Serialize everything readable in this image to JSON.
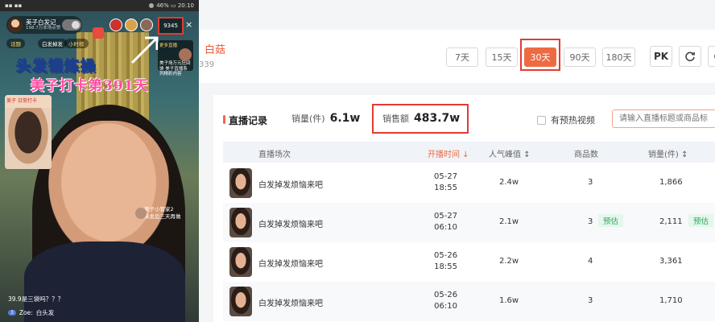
{
  "phone": {
    "status_left": "▪▪ ▪▪",
    "status_right": "46% ▭ 20:10",
    "host_name": "美子白发记",
    "host_likes": "198.7万本场点赞",
    "viewer_count": "9345",
    "close": "×",
    "tags": [
      "话题",
      "白发掉发",
      "小时榜"
    ],
    "more_live_title": "更多直播",
    "more_live_sub": "美子场万元狂回馈 美子直播系列精彩内容",
    "title_line1": "头发锻炼操",
    "title_line2": "美子打卡第391天",
    "product_banner": "美子 日常打卡",
    "assistant_name": "美子小管家2",
    "assistant_msg": "染发后三天再做",
    "comment1": "39.9是三袋吗？？？",
    "comment2_level": "3",
    "comment2_user": "Zoe:",
    "comment2_text": "白头发"
  },
  "header": {
    "brand": "白菇",
    "brand_sub": "339",
    "ranges": [
      "7天",
      "15天",
      "30天",
      "90天",
      "180天"
    ],
    "active_range": "30天",
    "pk_label": "PK"
  },
  "section": {
    "title": "直播记录",
    "sales_qty_label": "销量(件)",
    "sales_qty_value": "6.1w",
    "sales_amount_label": "销售额",
    "sales_amount_value": "483.7w",
    "preheat_label": "有预热视频",
    "search_placeholder": "请输入直播标题或商品标"
  },
  "table": {
    "headers": {
      "session": "直播场次",
      "start_time": "开播时间 ↓",
      "peak": "人气峰值 ↕",
      "goods": "商品数",
      "sales": "销量(件) ↕"
    },
    "estimate_label": "预估",
    "rows": [
      {
        "name": "白发掉发烦恼来吧",
        "date": "05-27",
        "time": "18:55",
        "peak": "2.4w",
        "goods": "3",
        "sales": "1,866",
        "estimated": false
      },
      {
        "name": "白发掉发烦恼来吧",
        "date": "05-27",
        "time": "06:10",
        "peak": "2.1w",
        "goods": "3",
        "sales": "2,111",
        "estimated": true
      },
      {
        "name": "白发掉发烦恼来吧",
        "date": "05-26",
        "time": "18:55",
        "peak": "2.2w",
        "goods": "4",
        "sales": "3,361",
        "estimated": false
      },
      {
        "name": "白发掉发烦恼来吧",
        "date": "05-26",
        "time": "06:10",
        "peak": "1.6w",
        "goods": "3",
        "sales": "1,710",
        "estimated": false
      }
    ]
  },
  "colors": {
    "accent": "#ee6a43",
    "highlight": "#e23b34",
    "estimate_bg": "#e5f6ec",
    "estimate_text": "#2ea65f"
  }
}
